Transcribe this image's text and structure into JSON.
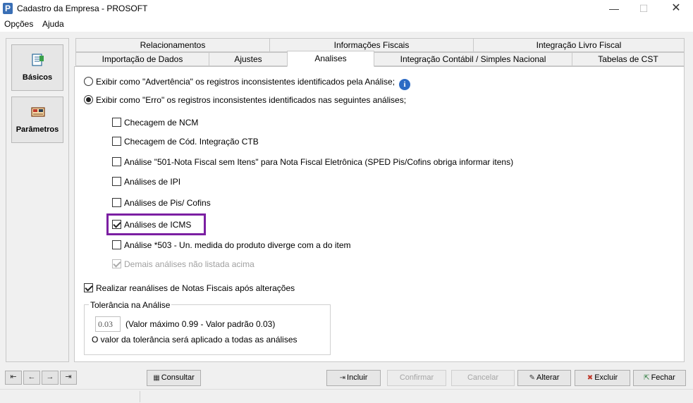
{
  "window": {
    "title": "Cadastro da Empresa - PROSOFT",
    "icon_letter": "P"
  },
  "window_controls": {
    "minimize": "—",
    "maximize": "☐",
    "close": "✕"
  },
  "menu": [
    "Opções",
    "Ajuda"
  ],
  "sidebar": {
    "items": [
      {
        "label": "Básicos",
        "icon": "document-icon"
      },
      {
        "label": "Parâmetros",
        "icon": "settings-board-icon"
      }
    ]
  },
  "tabs": {
    "row1": [
      "Relacionamentos",
      "Informações Fiscais",
      "Integração Livro Fiscal"
    ],
    "row2": [
      "Importação de Dados",
      "Ajustes",
      "Analises",
      "Integração Contábil / Simples Nacional",
      "Tabelas de CST"
    ],
    "active": "Analises"
  },
  "analises": {
    "radio_warning": "Exibir como \"Advertência\" os registros inconsistentes identificados pela Análise;",
    "radio_error": "Exibir como \"Erro\" os registros inconsistentes identificados nas seguintes análises;",
    "selected_radio": "error",
    "info_icon": "i",
    "checks": [
      {
        "label": "Checagem de NCM",
        "checked": false,
        "disabled": false
      },
      {
        "label": "Checagem de Cód. Integração CTB",
        "checked": false,
        "disabled": false
      },
      {
        "label": "Análise \"501-Nota Fiscal sem Itens\" para Nota Fiscal Eletrônica (SPED Pis/Cofins obriga informar itens)",
        "checked": false,
        "disabled": false
      },
      {
        "label": "Análises de IPI",
        "checked": false,
        "disabled": false
      },
      {
        "label": "Análises de Pis/ Cofins",
        "checked": false,
        "disabled": false
      },
      {
        "label": "Análises de ICMS",
        "checked": true,
        "disabled": false
      },
      {
        "label": "Análise *503 - Un. medida do produto diverge com a do item",
        "checked": false,
        "disabled": false
      },
      {
        "label": "Demais análises não listada acima",
        "checked": true,
        "disabled": true
      }
    ],
    "reanalise": {
      "label": "Realizar reanálises de Notas Fiscais após alterações",
      "checked": true
    },
    "tolerancia": {
      "title": "Tolerância na Análise",
      "value": "0.03",
      "desc": "(Valor máximo 0.99 - Valor padrão 0.03)",
      "note": "O valor da tolerância será aplicado a todas as análises"
    }
  },
  "nav_buttons": [
    "⇤",
    "←",
    "→",
    "⇥"
  ],
  "buttons": {
    "consultar": "Consultar",
    "incluir": "Incluir",
    "confirmar": "Confirmar",
    "cancelar": "Cancelar",
    "alterar": "Alterar",
    "excluir": "Excluir",
    "fechar": "Fechar"
  },
  "colors": {
    "highlight": "#7b1fa2",
    "info_icon": "#2d6bc4"
  }
}
